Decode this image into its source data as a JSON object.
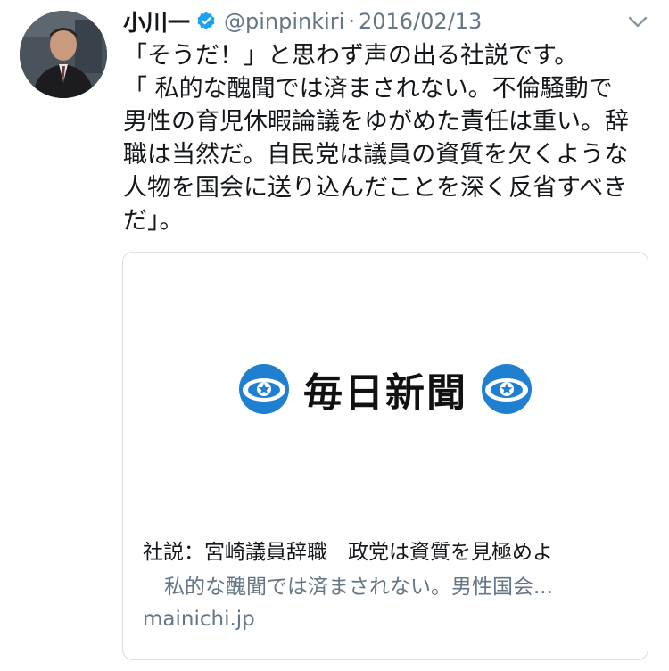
{
  "user": {
    "display_name": "小川一",
    "handle": "@pinpinkiri",
    "separator": "·",
    "date": "2016/02/13",
    "avatar_icon": "person-photo-icon",
    "verified_icon": "verified-badge-icon"
  },
  "tweet": {
    "lines": [
      "「そうだ！」と思わず声の出る社説です。",
      "「 私的な醜聞では済まされない。不倫騒動で",
      "男性の育児休暇論議をゆがめた責任は重い。辞",
      "職は当然だ。自民党は議員の資質を欠くような",
      "人物を国会に送り込んだことを深く反省すべき",
      "だ」。"
    ]
  },
  "card": {
    "logo_text": "毎日新聞",
    "title": "社説：宮崎議員辞職　政党は資質を見極めよ",
    "description": "私的な醜聞では済まされない。男性国会...",
    "domain": "mainichi.jp"
  },
  "colors": {
    "text": "#14171a",
    "secondary": "#657786",
    "verified": "#1da1f2",
    "border": "#d6dde3",
    "emblem_blue": "#1f7fd1"
  }
}
